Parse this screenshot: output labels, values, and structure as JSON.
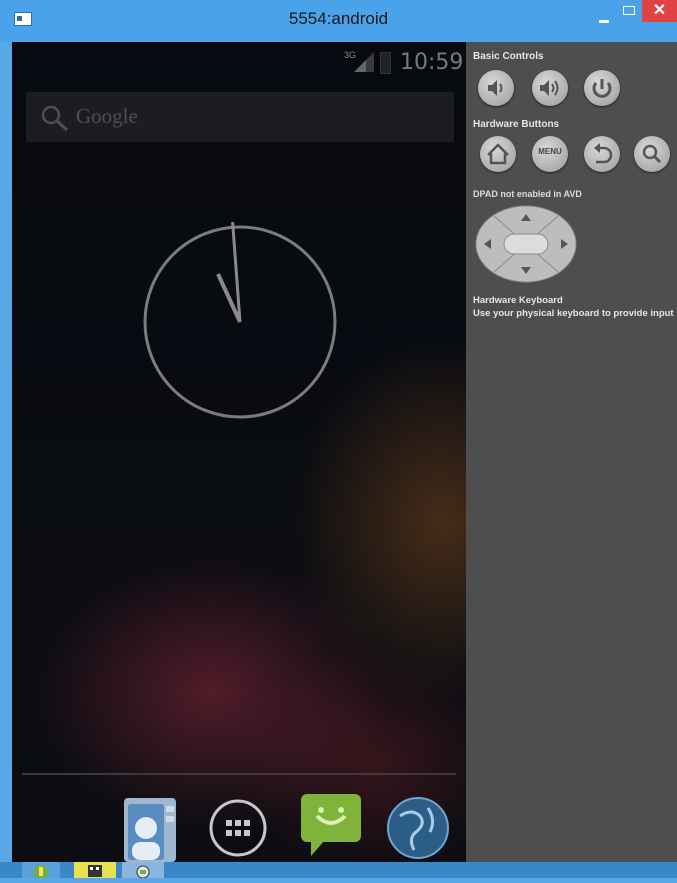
{
  "window": {
    "title": "5554:android",
    "close_glyph": "✕"
  },
  "status_bar": {
    "network": "3G",
    "time": "10:59"
  },
  "search": {
    "placeholder": "Google"
  },
  "clock": {
    "hour_hand_value": 11,
    "minute_hand_value": 59
  },
  "dock": {
    "items": [
      "people-icon",
      "app-drawer-icon",
      "messaging-icon",
      "browser-globe-icon"
    ]
  },
  "controls": {
    "basic_controls_label": "Basic Controls",
    "hardware_buttons_label": "Hardware Buttons",
    "menu_label": "MENU",
    "dpad_note": "DPAD not enabled in AVD",
    "keyboard_title": "Hardware Keyboard",
    "keyboard_note": "Use your physical keyboard to provide input"
  },
  "taskbar": {
    "items": [
      "android-sdk-icon",
      "media-app-icon",
      "emulator-icon"
    ]
  },
  "colors": {
    "title_bar": "#4aa3ea",
    "close_button": "#e04343",
    "panel_bg": "#4e4e4e",
    "screen_bg": "#0b0d12"
  }
}
